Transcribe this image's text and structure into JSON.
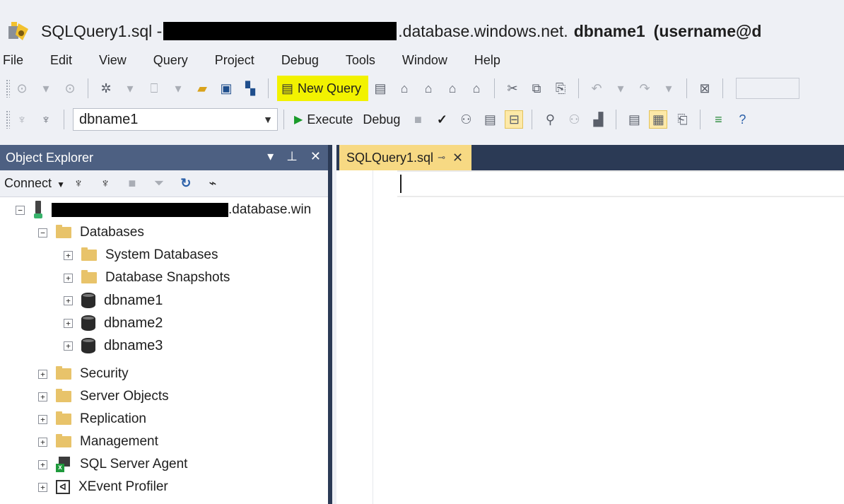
{
  "window": {
    "title_prefix": "SQLQuery1.sql -",
    "title_suffix": ".database.windows.net.",
    "title_db": "dbname1",
    "title_user": "(username@d"
  },
  "menu": [
    "File",
    "Edit",
    "View",
    "Query",
    "Project",
    "Debug",
    "Tools",
    "Window",
    "Help"
  ],
  "toolbar": {
    "new_query_label": "New Query",
    "database_selected": "dbname1",
    "execute_label": "Execute",
    "debug_label": "Debug"
  },
  "object_explorer": {
    "title": "Object Explorer",
    "connect_label": "Connect",
    "server_suffix": ".database.win",
    "databases_label": "Databases",
    "system_databases": "System Databases",
    "database_snapshots": "Database Snapshots",
    "databases": [
      "dbname1",
      "dbname2",
      "dbname3"
    ],
    "security": "Security",
    "server_objects": "Server Objects",
    "replication": "Replication",
    "management": "Management",
    "sql_server_agent": "SQL Server Agent",
    "xevent_profiler": "XEvent Profiler"
  },
  "editor": {
    "tab_label": "SQLQuery1.sql"
  },
  "colors": {
    "header_blue": "#4d6082",
    "dark_navy": "#2b3a55",
    "highlight_yellow": "#f2f200",
    "tab_gold": "#f7d983",
    "folder": "#e8c36a"
  }
}
